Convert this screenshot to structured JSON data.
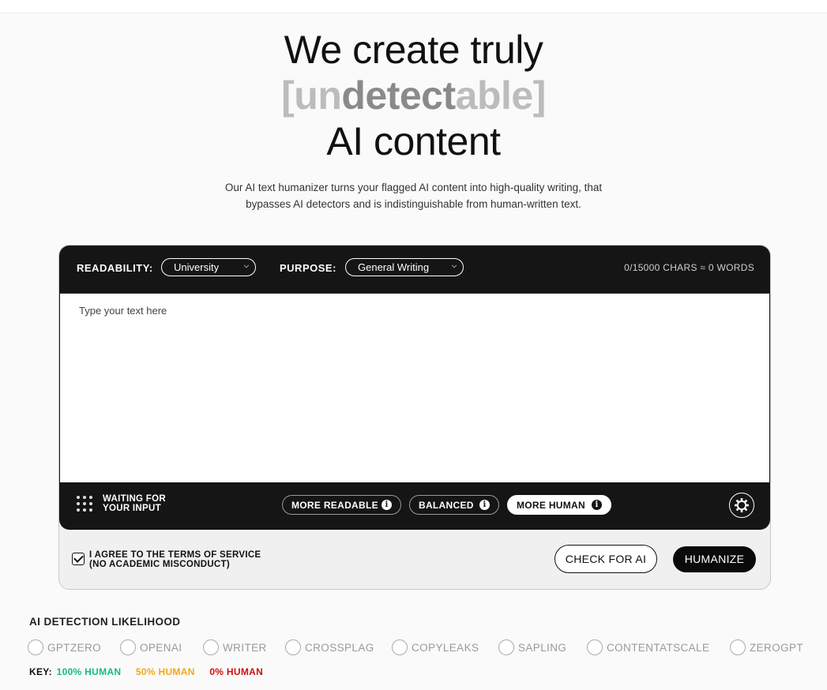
{
  "hero": {
    "line1": "We create truly",
    "accent_open": "[",
    "accent_part1": "un",
    "accent_part2": "detect",
    "accent_part3": "able",
    "accent_close": "]",
    "line3": "AI content"
  },
  "subtitle": {
    "line1": "Our AI text humanizer turns your flagged AI content into high-quality writing, that",
    "line2": "bypasses AI detectors and is indistinguishable from human-written text."
  },
  "toolbar": {
    "readability_label": "READABILITY:",
    "readability_value": "University",
    "purpose_label": "PURPOSE:",
    "purpose_value": "General Writing",
    "counter": "0/15000 CHARS ≈ 0 WORDS"
  },
  "editor": {
    "placeholder": "Type your text here"
  },
  "modebar": {
    "status_line1": "WAITING FOR",
    "status_line2": "YOUR INPUT",
    "modes": [
      {
        "label": "MORE READABLE"
      },
      {
        "label": "BALANCED"
      },
      {
        "label": "MORE HUMAN"
      }
    ],
    "active_mode": "MORE HUMAN"
  },
  "agreement": {
    "line1": "I AGREE TO THE TERMS OF SERVICE",
    "line2": "(NO ACADEMIC MISCONDUCT)",
    "checked": true
  },
  "actions": {
    "check_label": "CHECK FOR AI",
    "humanize_label": "HUMANIZE"
  },
  "detection": {
    "title": "AI DETECTION LIKELIHOOD",
    "detectors": [
      "GPTZERO",
      "OPENAI",
      "WRITER",
      "CROSSPLAG",
      "COPYLEAKS",
      "SAPLING",
      "CONTENTATSCALE",
      "ZEROGPT"
    ]
  },
  "key": {
    "label": "KEY:",
    "items": [
      {
        "text": "100% HUMAN",
        "color": "#16b98a"
      },
      {
        "text": "50% HUMAN",
        "color": "#f0a81c"
      },
      {
        "text": "0% HUMAN",
        "color": "#d01010"
      }
    ]
  },
  "colors": {
    "dark": "#151515",
    "accent_light": "#bcbcbc",
    "accent_dark": "#8a8a8a"
  }
}
